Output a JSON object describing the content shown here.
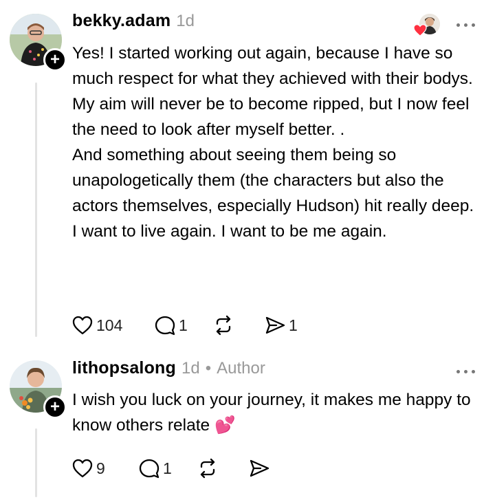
{
  "comments": [
    {
      "username": "bekky.adam",
      "time": "1d",
      "author_label": "",
      "body": "Yes! I started working out again, because I have so much respect for what they achieved with their bodys. My aim will never be to become ripped, but I now feel the need to look after myself better. .\nAnd something about seeing them being so unapologetically them (the characters but also the actors themselves, especially Hudson) hit really deep.\nI want to live again. I want to be me again.",
      "likes": "104",
      "replies": "1",
      "reposts": "",
      "shares": "1",
      "icons": [
        "heart-icon",
        "comment-icon",
        "repost-icon",
        "share-icon",
        "more-icon",
        "plus-icon"
      ]
    },
    {
      "username": "lithopsalong",
      "time": "1d",
      "separator": "•",
      "author_label": "Author",
      "body": "I wish you luck on your journey, it makes me happy to know others relate 💕",
      "likes": "9",
      "replies": "1",
      "reposts": "",
      "shares": "",
      "icons": [
        "heart-icon",
        "comment-icon",
        "repost-icon",
        "share-icon",
        "more-icon",
        "plus-icon"
      ]
    }
  ],
  "colors": {
    "text": "#000000",
    "muted": "#999999",
    "thread_line": "#e3e3e3",
    "like_heart": "#ff3040"
  }
}
